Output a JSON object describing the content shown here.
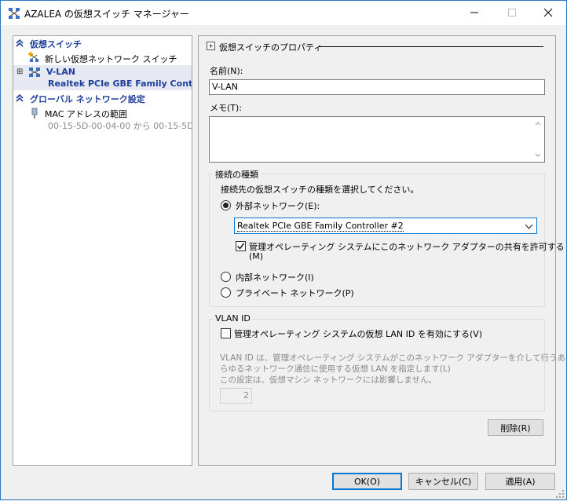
{
  "window": {
    "title": "AZALEA の仮想スイッチ マネージャー",
    "minimize_icon": "minimize-icon",
    "maximize_icon": "maximize-icon",
    "close_icon": "close-icon"
  },
  "left": {
    "section1": {
      "label": "仮想スイッチ",
      "icon": "chevron-up-icon"
    },
    "new_switch": {
      "label": "新しい仮想ネットワーク スイッチ",
      "icon": "new-switch-icon"
    },
    "vlan": {
      "name": "V-LAN",
      "adapter": "Realtek PCIe GBE Family Cont...",
      "icon": "network-switch-icon",
      "expander": "⊞"
    },
    "section2": {
      "label": "グローバル ネットワーク設定",
      "icon": "chevron-up-icon"
    },
    "mac": {
      "label": "MAC アドレスの範囲",
      "value": "00-15-5D-00-04-00 から 00-15-5D-...",
      "icon": "mac-address-icon"
    }
  },
  "props": {
    "header": "仮想スイッチのプロパティ",
    "name_label": "名前(N):",
    "name_value": "V-LAN",
    "memo_label": "メモ(T):",
    "memo_value": "",
    "conn_group_label": "接続の種類",
    "conn_instruction": "接続先の仮想スイッチの種類を選択してください。",
    "radio_external": "外部ネットワーク(E):",
    "adapter_selected": "Realtek PCIe GBE Family Controller #2",
    "share_line1": "管理オペレーティング システムにこのネットワーク アダプターの共有を許可する",
    "share_line2": "(M)",
    "share_checked": true,
    "radio_internal": "内部ネットワーク(I)",
    "radio_private": "プライベート ネットワーク(P)",
    "selected_type": "external",
    "vlan_group_label": "VLAN ID",
    "vlan_check_label": "管理オペレーティング システムの仮想 LAN ID を有効にする(V)",
    "vlan_checked": false,
    "vlan_desc_line1": "VLAN ID は、管理オペレーティング システムがこのネットワーク アダプターを介して行うあ",
    "vlan_desc_line2": "らゆるネットワーク通信に使用する仮想 LAN を指定します(L)",
    "vlan_desc_line3": "この設定は、仮想マシン ネットワークには影響しません。",
    "vlan_value": "2",
    "delete_button": "削除(R)"
  },
  "footer": {
    "ok": "OK(O)",
    "cancel": "キャンセル(C)",
    "apply": "適用(A)"
  },
  "colors": {
    "accent": "#0078d7",
    "section_heading": "#1f3f9a",
    "selection_bg": "#e6e9f1",
    "disabled_text": "#8a8a8a"
  }
}
